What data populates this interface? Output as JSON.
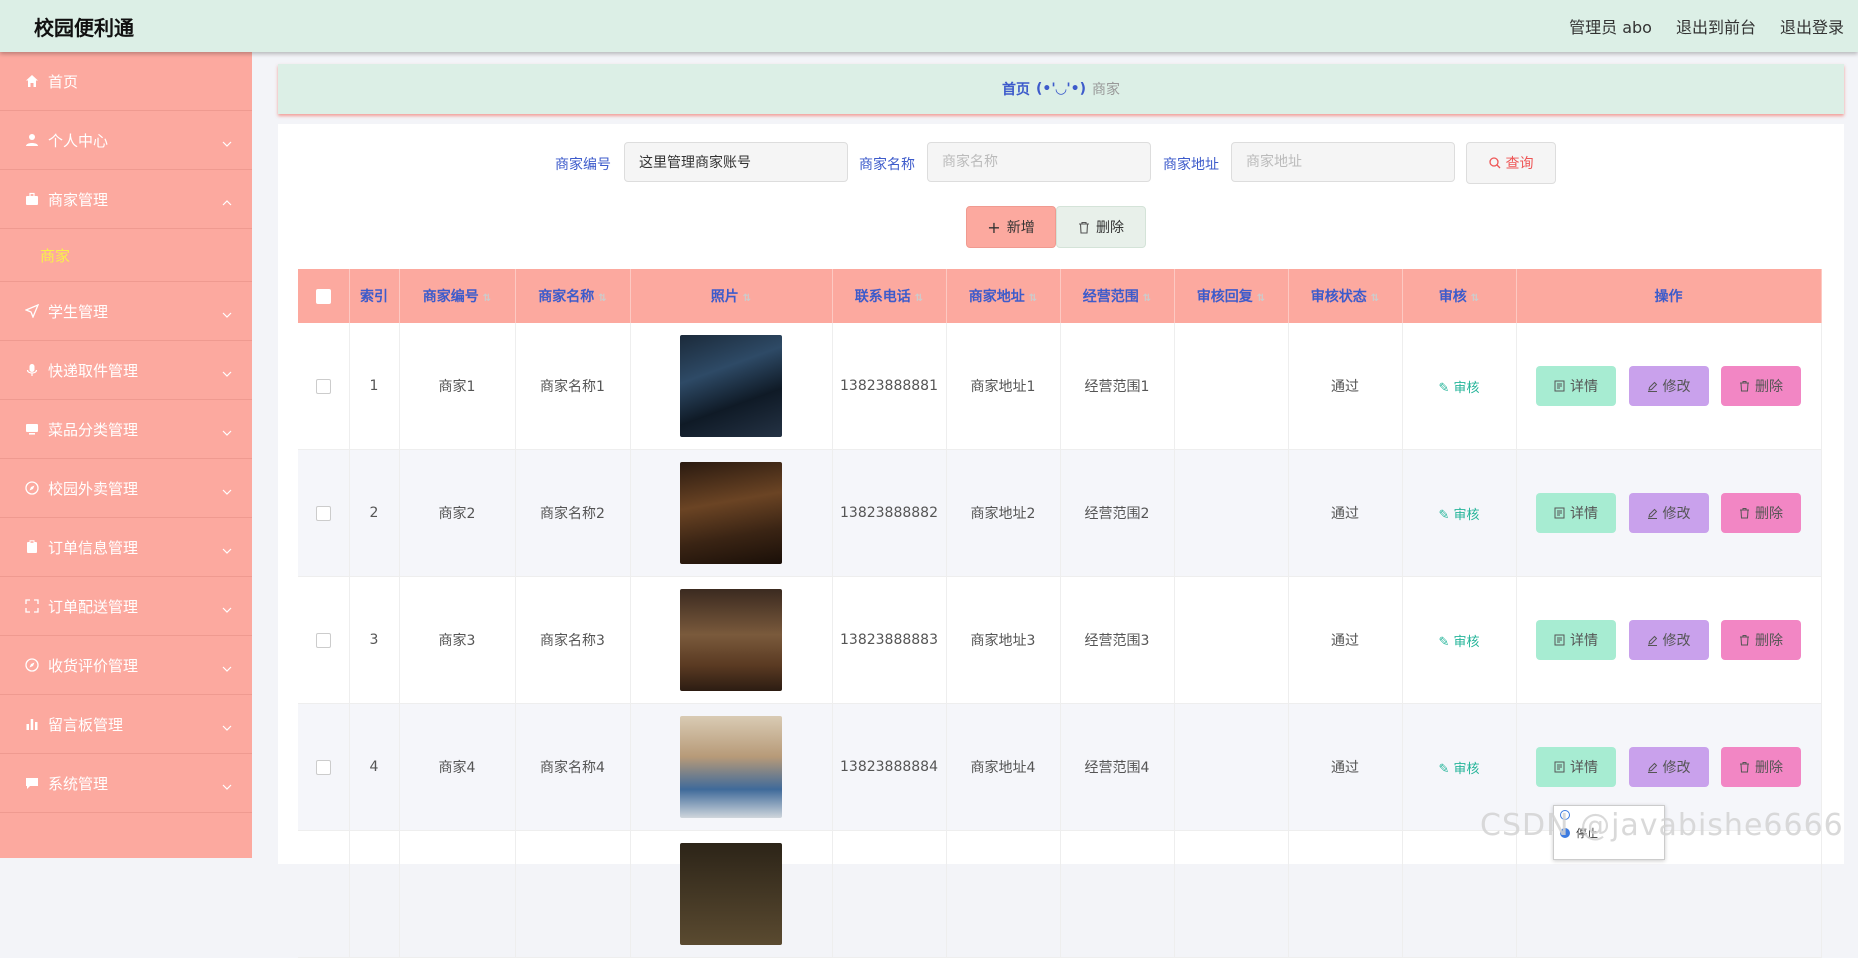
{
  "app": {
    "title": "校园便利通"
  },
  "header": {
    "user": "管理员 abo",
    "front": "退出到前台",
    "logout": "退出登录"
  },
  "sidebar": {
    "items": [
      {
        "label": "首页",
        "icon": "home-icon",
        "chevron": false
      },
      {
        "label": "个人中心",
        "icon": "user-icon",
        "chevron": true
      },
      {
        "label": "商家管理",
        "icon": "briefcase-icon",
        "chevron": true,
        "expanded": true,
        "children": [
          "商家"
        ]
      },
      {
        "label": "学生管理",
        "icon": "send-icon",
        "chevron": true
      },
      {
        "label": "快递取件管理",
        "icon": "microphone-icon",
        "chevron": true
      },
      {
        "label": "菜品分类管理",
        "icon": "monitor-icon",
        "chevron": true
      },
      {
        "label": "校园外卖管理",
        "icon": "compass-icon",
        "chevron": true
      },
      {
        "label": "订单信息管理",
        "icon": "clipboard-icon",
        "chevron": true
      },
      {
        "label": "订单配送管理",
        "icon": "fullscreen-icon",
        "chevron": true
      },
      {
        "label": "收货评价管理",
        "icon": "compass-icon",
        "chevron": true
      },
      {
        "label": "留言板管理",
        "icon": "bar-chart-icon",
        "chevron": true
      },
      {
        "label": "系统管理",
        "icon": "chat-icon",
        "chevron": true
      }
    ]
  },
  "breadcrumb": {
    "home": "首页",
    "sep": "(•'◡'•)",
    "current": "商家"
  },
  "search": {
    "f1": {
      "label": "商家编号",
      "value": "这里管理商家账号",
      "placeholder": ""
    },
    "f2": {
      "label": "商家名称",
      "placeholder": "商家名称"
    },
    "f3": {
      "label": "商家地址",
      "placeholder": "商家地址"
    },
    "query": "查询"
  },
  "actions": {
    "add": "新增",
    "delete": "删除"
  },
  "table": {
    "headers": [
      "索引",
      "商家编号",
      "商家名称",
      "照片",
      "联系电话",
      "商家地址",
      "经营范围",
      "审核回复",
      "审核状态",
      "审核",
      "操作"
    ],
    "rows": [
      {
        "index": "1",
        "code": "商家1",
        "name": "商家名称1",
        "phone": "13823888881",
        "address": "商家地址1",
        "scope": "经营范围1",
        "reply": "",
        "status": "通过",
        "photo": "restaurant-photo-1"
      },
      {
        "index": "2",
        "code": "商家2",
        "name": "商家名称2",
        "phone": "13823888882",
        "address": "商家地址2",
        "scope": "经营范围2",
        "reply": "",
        "status": "通过",
        "photo": "restaurant-photo-2"
      },
      {
        "index": "3",
        "code": "商家3",
        "name": "商家名称3",
        "phone": "13823888883",
        "address": "商家地址3",
        "scope": "经营范围3",
        "reply": "",
        "status": "通过",
        "photo": "restaurant-photo-3"
      },
      {
        "index": "4",
        "code": "商家4",
        "name": "商家名称4",
        "phone": "13823888884",
        "address": "商家地址4",
        "scope": "经营范围4",
        "reply": "",
        "status": "通过",
        "photo": "restaurant-photo-4"
      }
    ],
    "audit_label": "审核",
    "op_detail": "详情",
    "op_edit": "修改",
    "op_delete": "删除"
  },
  "popup": {
    "opt1": "",
    "opt2": "停止"
  },
  "watermark": "CSDN @javabishe6666"
}
